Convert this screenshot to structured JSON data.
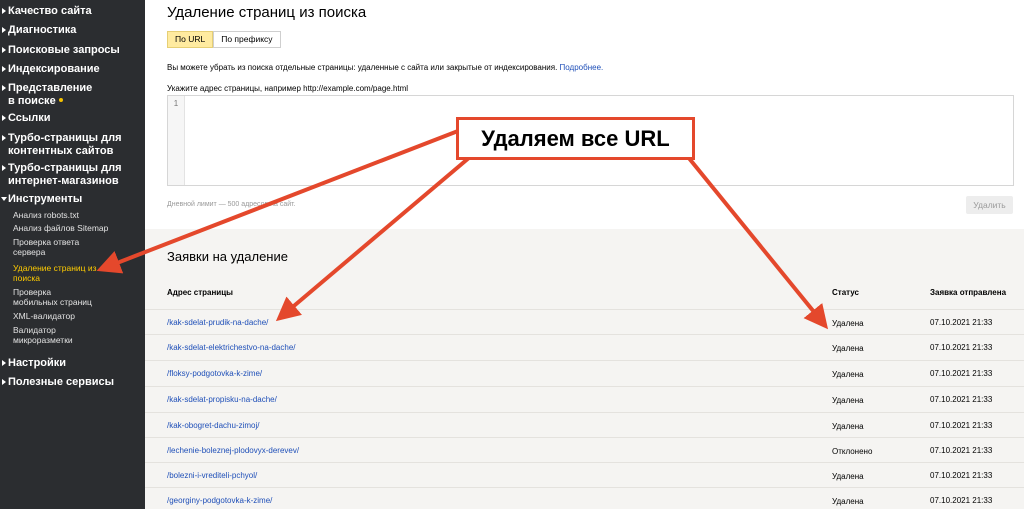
{
  "sidebar": {
    "items": [
      {
        "label": "Качество сайта"
      },
      {
        "label": "Диагностика"
      },
      {
        "label": "Поисковые запросы"
      },
      {
        "label": "Индексирование"
      },
      {
        "label": "Представление",
        "label2": "в поиске"
      },
      {
        "label": "Ссылки"
      },
      {
        "label": "Турбо-страницы для",
        "label2": "контентных сайтов"
      },
      {
        "label": "Турбо-страницы для",
        "label2": "интернет-магазинов"
      },
      {
        "label": "Инструменты"
      },
      {
        "label": "Настройки"
      },
      {
        "label": "Полезные сервисы"
      }
    ],
    "tools": [
      {
        "label": "Анализ robots.txt"
      },
      {
        "label": "Анализ файлов Sitemap"
      },
      {
        "label": "Проверка ответа",
        "label2": "сервера"
      },
      {
        "label": "Удаление страниц из",
        "label2": "поиска"
      },
      {
        "label": "Проверка",
        "label2": "мобильных страниц"
      },
      {
        "label": "XML-валидатор"
      },
      {
        "label": "Валидатор",
        "label2": "микроразметки"
      }
    ]
  },
  "main": {
    "title": "Удаление страниц из поиска",
    "tabs": [
      {
        "label": "По URL"
      },
      {
        "label": "По префиксу"
      }
    ],
    "description": "Вы можете убрать из поиска отдельные страницы: удаленные с сайта или закрытые от индексирования.",
    "more_link": "Подробнее.",
    "input_label": "Укажите адрес страницы, например http://example.com/page.html",
    "line_number": "1",
    "limit_text": "Дневной лимит — 500 адресов на сайт.",
    "delete_label": "Удалить"
  },
  "requests": {
    "title": "Заявки на удаление",
    "columns": [
      "Адрес страницы",
      "Статус",
      "Заявка отправлена"
    ],
    "rows": [
      {
        "url": "/kak-sdelat-prudik-na-dache/",
        "status": "Удалена",
        "date": "07.10.2021 21:33"
      },
      {
        "url": "/kak-sdelat-elektrichestvo-na-dache/",
        "status": "Удалена",
        "date": "07.10.2021 21:33"
      },
      {
        "url": "/floksy-podgotovka-k-zime/",
        "status": "Удалена",
        "date": "07.10.2021 21:33"
      },
      {
        "url": "/kak-sdelat-propisku-na-dache/",
        "status": "Удалена",
        "date": "07.10.2021 21:33"
      },
      {
        "url": "/kak-obogret-dachu-zimoj/",
        "status": "Удалена",
        "date": "07.10.2021 21:33"
      },
      {
        "url": "/lechenie-boleznej-plodovyx-derevev/",
        "status": "Отклонено",
        "date": "07.10.2021 21:33"
      },
      {
        "url": "/bolezni-i-vrediteli-pchyol/",
        "status": "Удалена",
        "date": "07.10.2021 21:33"
      },
      {
        "url": "/georginy-podgotovka-k-zime/",
        "status": "Удалена",
        "date": "07.10.2021 21:33"
      }
    ]
  },
  "annotation": {
    "text": "Удаляем все URL",
    "color": "#e4482c"
  }
}
